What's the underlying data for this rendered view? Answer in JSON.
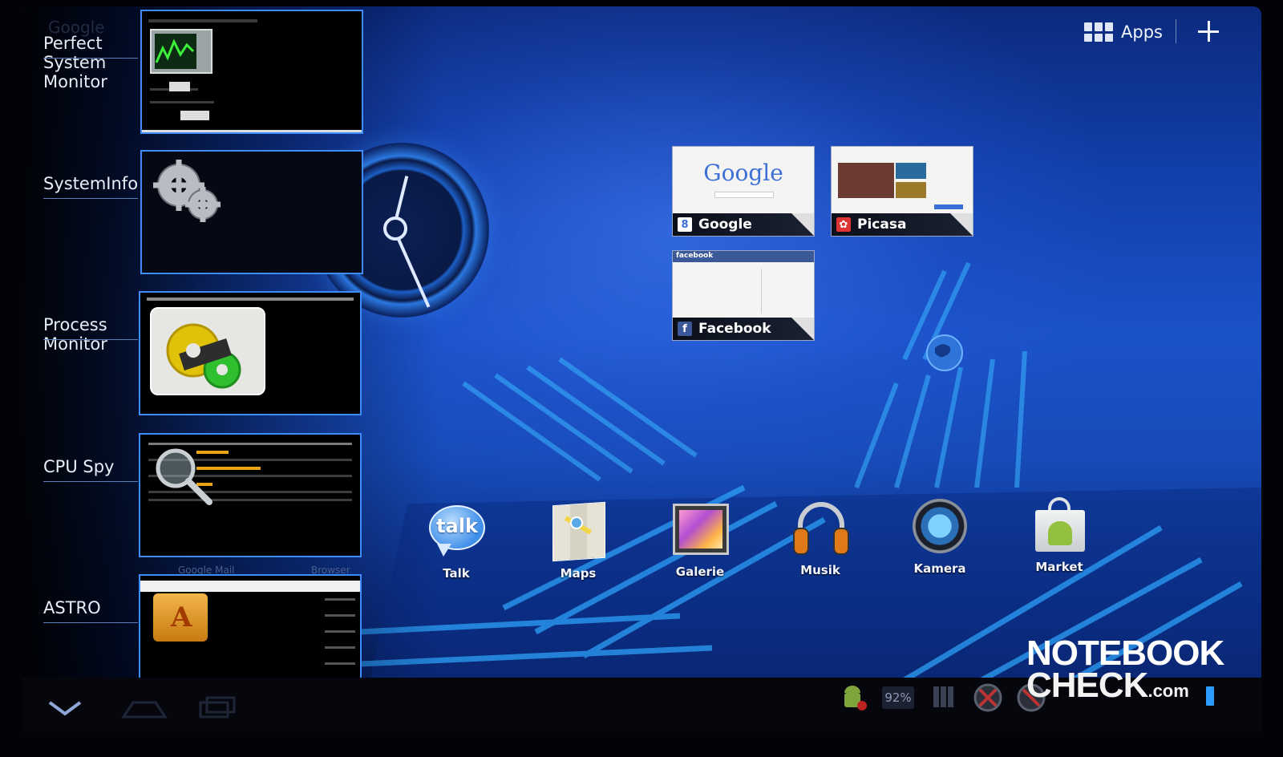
{
  "recent_apps": [
    {
      "label_line1": "Perfect",
      "label_line2": "System",
      "label_line3": "Monitor"
    },
    {
      "label_line1": "SystemInfo"
    },
    {
      "label_line1": "Process",
      "label_line2": "Monitor"
    },
    {
      "label_line1": "CPU Spy"
    },
    {
      "label_line1": "ASTRO"
    }
  ],
  "thumbnail_text": {
    "astro_tabs": "Google Mail",
    "astro_browser": "Browser"
  },
  "top_bar": {
    "search_hint": "Google",
    "apps_label": "Apps"
  },
  "bookmarks": [
    {
      "label": "Google",
      "logo_text": "Google"
    },
    {
      "label": "Picasa"
    },
    {
      "label": "Facebook",
      "logo_text": "facebook"
    }
  ],
  "dock": [
    {
      "label": "Talk",
      "icon": "talk-icon",
      "icon_text": "talk"
    },
    {
      "label": "Maps",
      "icon": "maps-icon"
    },
    {
      "label": "Galerie",
      "icon": "gallery-icon"
    },
    {
      "label": "Musik",
      "icon": "headphones-icon"
    },
    {
      "label": "Kamera",
      "icon": "camera-lens-icon"
    },
    {
      "label": "Market",
      "icon": "market-bag-icon"
    }
  ],
  "status_bar": {
    "battery_percent": "92%"
  },
  "watermark": {
    "line1": "NOTEBOOK",
    "line2": "CHECK",
    "suffix": ".com"
  },
  "colors": {
    "accent": "#3f8cff",
    "wallpaper_mid": "#1a52c8",
    "wallpaper_dark": "#06163f"
  }
}
